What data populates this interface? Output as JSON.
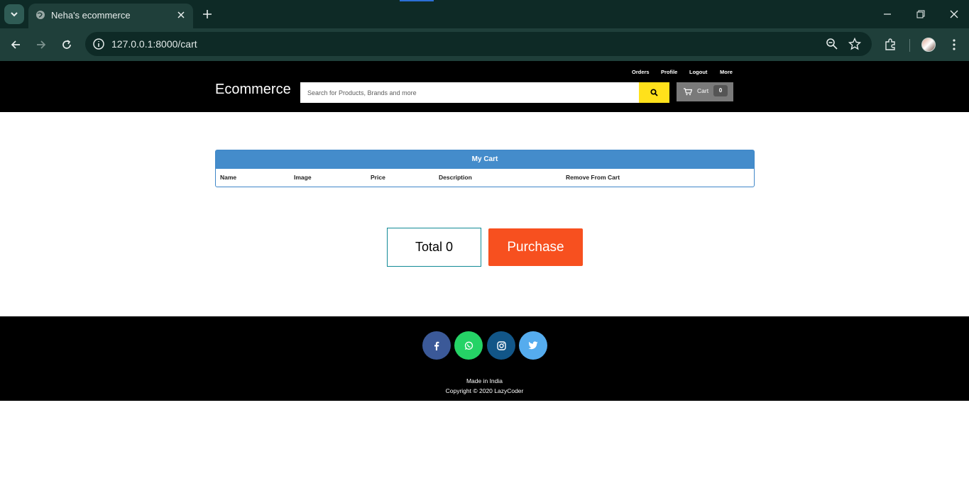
{
  "browser": {
    "tab_title": "Neha's ecommerce",
    "url": "127.0.0.1:8000/cart"
  },
  "header": {
    "brand": "Ecommerce",
    "nav": [
      "Orders",
      "Profile",
      "Logout",
      "More"
    ],
    "search_placeholder": "Search for Products, Brands and more",
    "cart_label": "Cart",
    "cart_count": "0"
  },
  "cart": {
    "title": "My Cart",
    "columns": [
      "Name",
      "Image",
      "Price",
      "Description",
      "Remove From Cart"
    ]
  },
  "summary": {
    "total": "Total 0",
    "purchase_label": "Purchase"
  },
  "footer": {
    "social": [
      "facebook-icon",
      "whatsapp-icon",
      "instagram-icon",
      "twitter-icon"
    ],
    "made_in": "Made in India",
    "copyright": "Copyright © 2020 LazyCoder"
  },
  "colors": {
    "search_button": "#ffe11b",
    "cart_header": "#448ccb",
    "purchase": "#f7501f",
    "facebook": "#3b5998",
    "whatsapp": "#25d366",
    "instagram": "#125688",
    "twitter": "#55acee"
  }
}
